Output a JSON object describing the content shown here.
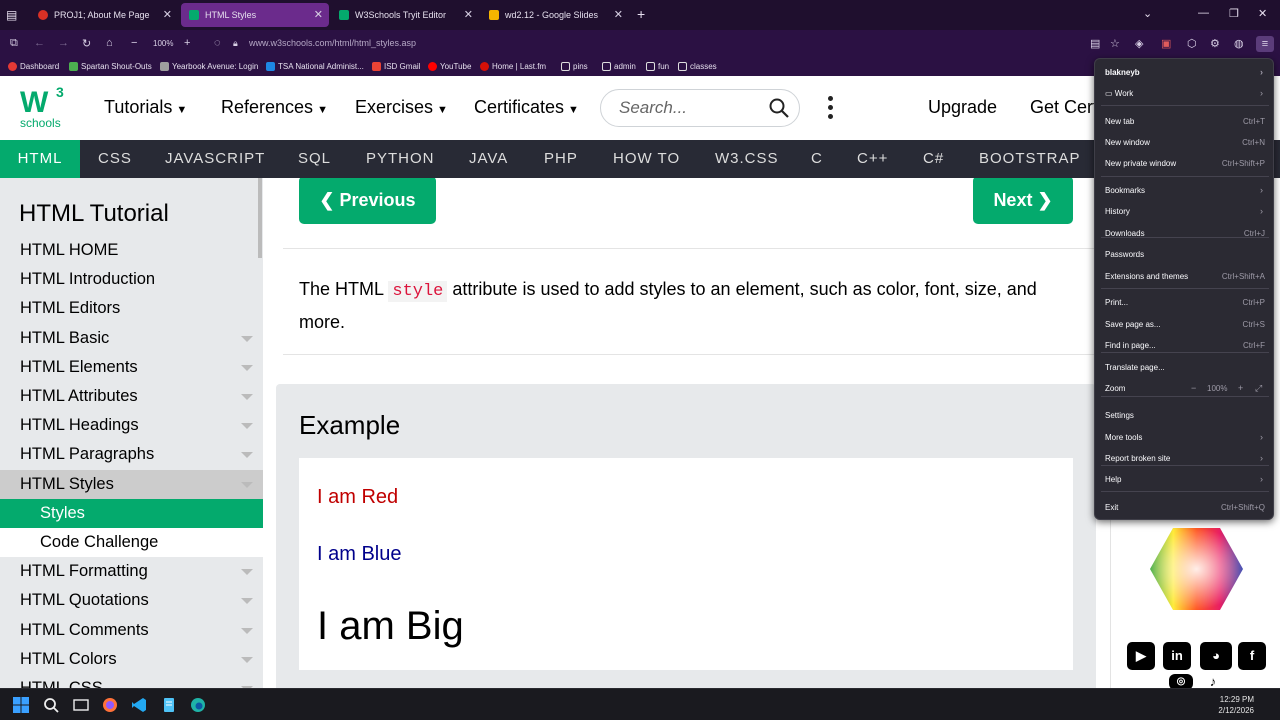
{
  "tabs": [
    {
      "label": "PROJ1; About Me Page",
      "fav_color": "#d93025"
    },
    {
      "label": "HTML Styles",
      "fav_color": "#04aa6d"
    },
    {
      "label": "W3Schools Tryit Editor",
      "fav_color": "#04aa6d"
    },
    {
      "label": "wd2.12 - Google Slides",
      "fav_color": "#f4b400"
    }
  ],
  "navbar": {
    "zoom": "100%",
    "url": "www.w3schools.com/html/html_styles.asp"
  },
  "bookmarks": [
    {
      "label": "Dashboard",
      "color": "#e53935"
    },
    {
      "label": "Spartan Shout-Outs",
      "color": "#4caf50"
    },
    {
      "label": "Yearbook Avenue: Login",
      "color": "#9e9e9e"
    },
    {
      "label": "TSA National Administ...",
      "color": "#1e88e5"
    },
    {
      "label": "ISD Gmail",
      "color": "#ea4335"
    },
    {
      "label": "YouTube",
      "color": "#ff0000"
    },
    {
      "label": "Home | Last.fm",
      "color": "#d51007"
    },
    {
      "label": "pins",
      "color": "folder"
    },
    {
      "label": "admin",
      "color": "folder"
    },
    {
      "label": "fun",
      "color": "folder"
    },
    {
      "label": "classes",
      "color": "folder"
    }
  ],
  "header": {
    "logo_text": "W",
    "logo_sup": "3",
    "logo_sub": "schools",
    "nav": [
      "Tutorials",
      "References",
      "Exercises",
      "Certificates"
    ],
    "search_placeholder": "Search...",
    "upgrade": "Upgrade",
    "get_cert": "Get Cert"
  },
  "subnav": [
    "HTML",
    "CSS",
    "JAVASCRIPT",
    "SQL",
    "PYTHON",
    "JAVA",
    "PHP",
    "HOW TO",
    "W3.CSS",
    "C",
    "C++",
    "C#",
    "BOOTSTRAP"
  ],
  "sidebar": {
    "title": "HTML Tutorial",
    "items": [
      {
        "label": "HTML HOME",
        "arrow": false,
        "state": ""
      },
      {
        "label": "HTML Introduction",
        "arrow": false,
        "state": ""
      },
      {
        "label": "HTML Editors",
        "arrow": false,
        "state": ""
      },
      {
        "label": "HTML Basic",
        "arrow": true,
        "state": ""
      },
      {
        "label": "HTML Elements",
        "arrow": true,
        "state": ""
      },
      {
        "label": "HTML Attributes",
        "arrow": true,
        "state": ""
      },
      {
        "label": "HTML Headings",
        "arrow": true,
        "state": ""
      },
      {
        "label": "HTML Paragraphs",
        "arrow": true,
        "state": ""
      },
      {
        "label": "HTML Styles",
        "arrow": true,
        "state": "sel"
      },
      {
        "label": "Styles",
        "arrow": false,
        "state": "green"
      },
      {
        "label": "Code Challenge",
        "arrow": false,
        "state": "plain"
      },
      {
        "label": "HTML Formatting",
        "arrow": true,
        "state": ""
      },
      {
        "label": "HTML Quotations",
        "arrow": true,
        "state": ""
      },
      {
        "label": "HTML Comments",
        "arrow": true,
        "state": ""
      },
      {
        "label": "HTML Colors",
        "arrow": true,
        "state": ""
      },
      {
        "label": "HTML CSS",
        "arrow": true,
        "state": ""
      }
    ]
  },
  "main": {
    "prev": "Previous",
    "next": "Next",
    "intro_before": "The HTML",
    "intro_code": "style",
    "intro_after": "attribute is used to add styles to an element, such as color, font, size, and more.",
    "example_title": "Example",
    "ex_red": "I am Red",
    "ex_blue": "I am Blue",
    "ex_big": "I am Big"
  },
  "menu": {
    "profile": "blakneyb",
    "work": "Work",
    "items": [
      {
        "label": "New tab",
        "shortcut": "Ctrl+T"
      },
      {
        "label": "New window",
        "shortcut": "Ctrl+N"
      },
      {
        "label": "New private window",
        "shortcut": "Ctrl+Shift+P"
      },
      {
        "label": "Bookmarks",
        "shortcut": ""
      },
      {
        "label": "History",
        "shortcut": ""
      },
      {
        "label": "Downloads",
        "shortcut": "Ctrl+J"
      },
      {
        "label": "Passwords",
        "shortcut": ""
      },
      {
        "label": "Extensions and themes",
        "shortcut": "Ctrl+Shift+A"
      },
      {
        "label": "Print...",
        "shortcut": "Ctrl+P"
      },
      {
        "label": "Save page as...",
        "shortcut": "Ctrl+S"
      },
      {
        "label": "Find in page...",
        "shortcut": "Ctrl+F"
      },
      {
        "label": "Translate page...",
        "shortcut": ""
      },
      {
        "label": "Zoom",
        "shortcut": ""
      },
      {
        "label": "Settings",
        "shortcut": ""
      },
      {
        "label": "More tools",
        "shortcut": ""
      },
      {
        "label": "Report broken site",
        "shortcut": ""
      },
      {
        "label": "Help",
        "shortcut": ""
      },
      {
        "label": "Exit",
        "shortcut": "Ctrl+Shift+Q"
      }
    ],
    "zoom_value": "100%"
  },
  "taskbar": {
    "time": "12:29 PM",
    "date": "2/12/2026"
  }
}
